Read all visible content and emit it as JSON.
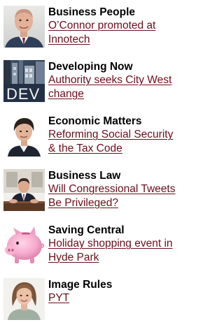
{
  "items": [
    {
      "category": "Business People",
      "headline": "O’Connor promoted at Innotech",
      "thumb_icon": "man-headshot-photo"
    },
    {
      "category": "Developing Now",
      "headline": "Authority seeks City West change",
      "thumb_icon": "building-sign-photo",
      "thumb_text": "DEV"
    },
    {
      "category": "Economic Matters",
      "headline": "Reforming Social Security & the Tax Code",
      "thumb_icon": "man-portrait-photo"
    },
    {
      "category": "Business Law",
      "headline": "Will Congressional Tweets Be Privileged?",
      "thumb_icon": "man-at-desk-photo"
    },
    {
      "category": "Saving Central",
      "headline": "Holiday shopping event in Hyde Park",
      "thumb_icon": "piggy-bank-photo"
    },
    {
      "category": "Image Rules",
      "headline": "PYT",
      "thumb_icon": "woman-headshot-photo"
    }
  ],
  "colors": {
    "link": "#6b0e1a",
    "title": "#000000"
  }
}
